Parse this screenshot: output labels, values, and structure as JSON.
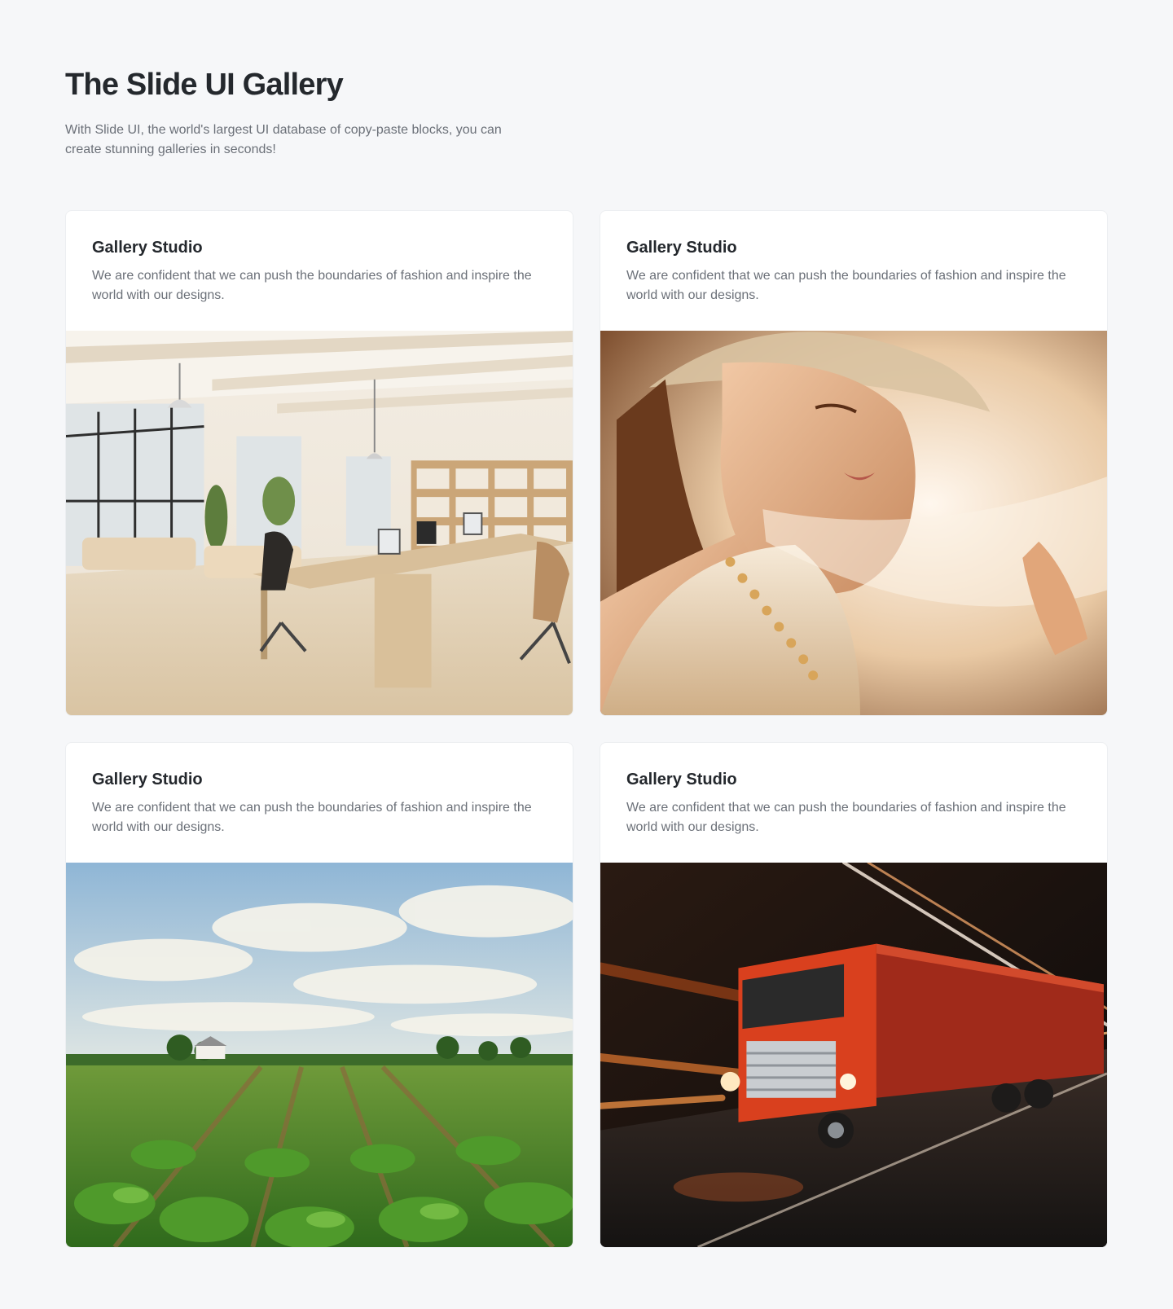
{
  "header": {
    "title": "The Slide UI Gallery",
    "subtitle": "With Slide UI, the world's largest UI database of copy-paste blocks, you can create stunning galleries in seconds!"
  },
  "cards": [
    {
      "title": "Gallery Studio",
      "description": "We are confident that we can push the boundaries of fashion and inspire the world with our designs.",
      "image": "office-interior-image"
    },
    {
      "title": "Gallery Studio",
      "description": "We are confident that we can push the boundaries of fashion and inspire the world with our designs.",
      "image": "fashion-portrait-image"
    },
    {
      "title": "Gallery Studio",
      "description": "We are confident that we can push the boundaries of fashion and inspire the world with our designs.",
      "image": "farm-field-image"
    },
    {
      "title": "Gallery Studio",
      "description": "We are confident that we can push the boundaries of fashion and inspire the world with our designs.",
      "image": "red-truck-image"
    }
  ],
  "colors": {
    "background": "#f6f7f9",
    "card": "#ffffff",
    "heading": "#24282d",
    "body_text": "#6b7078"
  }
}
